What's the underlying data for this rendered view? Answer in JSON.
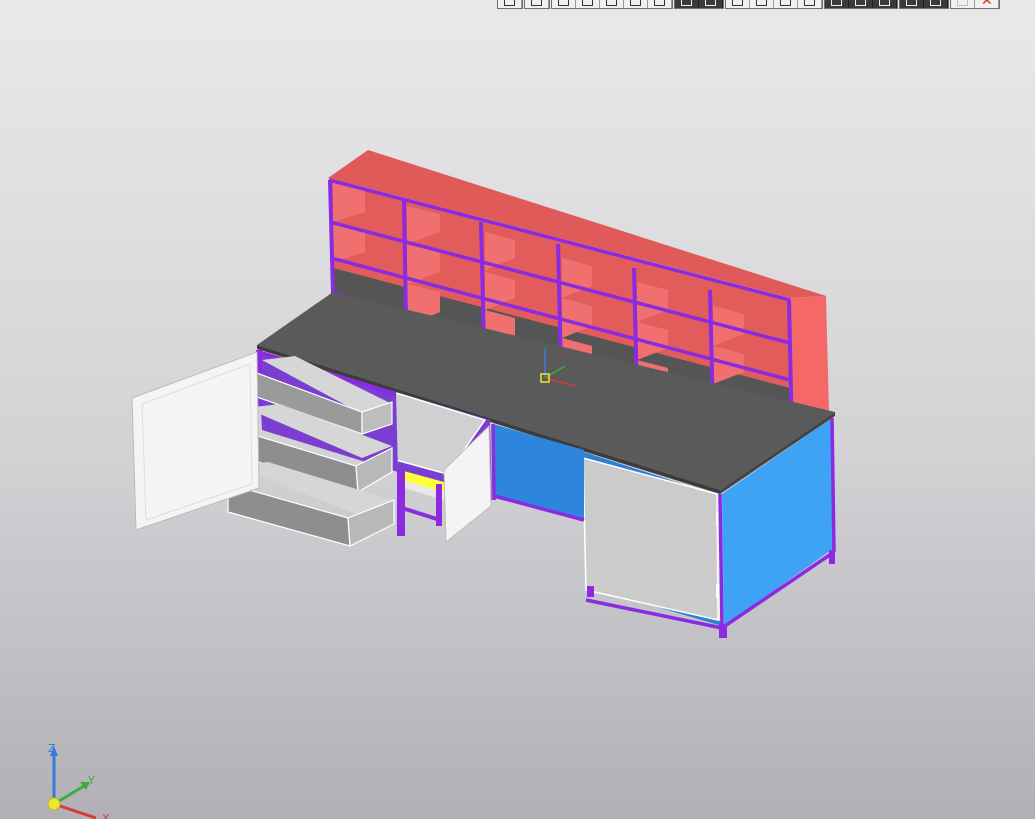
{
  "viewport": {
    "background_top": "#e9e9ea",
    "background_bottom": "#b0b0b6"
  },
  "toolbar": {
    "groups": [
      {
        "name": "view-orient",
        "buttons": [
          "rect-zoom-icon"
        ],
        "theme": "light"
      },
      {
        "name": "navigation",
        "buttons": [
          "rotate-icon",
          "pan-icon",
          "zoom-icon"
        ],
        "theme": "light"
      },
      {
        "name": "display-mode",
        "buttons": [
          "wireframe-icon",
          "shaded-icon"
        ],
        "theme": "dark"
      },
      {
        "name": "section",
        "buttons": [
          "measure-icon",
          "section-icon",
          "plane-icon"
        ],
        "theme": "light"
      },
      {
        "name": "tools",
        "buttons": [
          "constraint-icon",
          "library-icon",
          "edit-sketch-icon"
        ],
        "theme": "dark"
      },
      {
        "name": "pin",
        "buttons": [
          "pin-icon",
          "cursor-icon"
        ],
        "theme": "dark"
      },
      {
        "name": "window",
        "buttons": [
          "confirm-icon",
          "close-icon"
        ],
        "theme": "light"
      }
    ]
  },
  "model": {
    "colors": {
      "frame": "#8a2be2",
      "frame_dark": "#6a1bb8",
      "worktop": "#5a5a5a",
      "shelf_front": "#e05a5a",
      "shelf_side": "#f06262",
      "shelf_inner": "#e86060",
      "cabinet_blue": "#3ea2f5",
      "cabinet_blue_dark": "#2a7fd6",
      "door_white": "#f4f4f4",
      "door_grey": "#c8c8c8",
      "drawer_top": "#d4d4d4",
      "drawer_front": "#9a9a9a",
      "drawer_side": "#bcbcbc",
      "accent_yellow": "#ffff3a"
    }
  },
  "triad": {
    "z_label": "Z",
    "y_label": "Y",
    "x_label": "X",
    "z_color": "#2f7fd8",
    "y_color": "#3cab3c",
    "x_color": "#d83a3a",
    "origin_color": "#e8e830"
  }
}
